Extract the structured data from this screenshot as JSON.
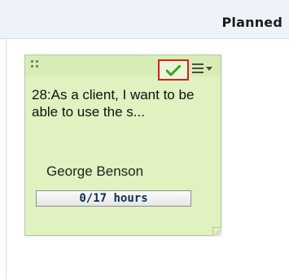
{
  "board": {
    "column_title": "Planned"
  },
  "card": {
    "title": "28:As a client, I want to be able to use the s...",
    "owner": "George Benson",
    "hours_label": "0/17 hours",
    "hours_progress": 0,
    "colors": {
      "card_bg": "#dff2bf",
      "highlight_border": "#d81e1e",
      "check": "#3aa21f"
    },
    "icons": {
      "drag": "drag-handle-icon",
      "done": "checkmark-icon",
      "menu": "menu-icon"
    }
  }
}
